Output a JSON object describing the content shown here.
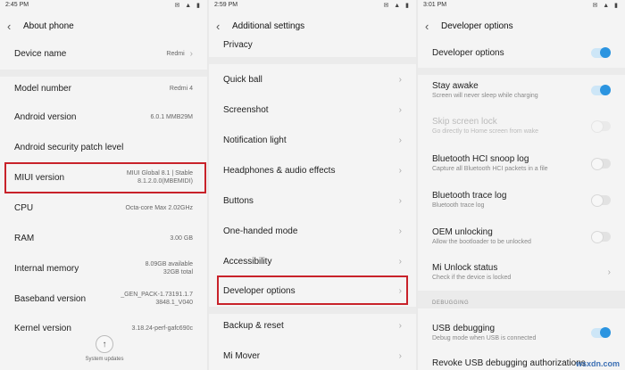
{
  "panel1": {
    "time": "2:45 PM",
    "status_icons": "✉ ▲ ▮",
    "title": "About phone",
    "rows": [
      {
        "label": "Device name",
        "value": "Redmi"
      },
      {
        "label": "Model number",
        "value": "Redmi 4"
      },
      {
        "label": "Android version",
        "value": "6.0.1 MMB29M"
      },
      {
        "label": "Android security patch level",
        "value": ""
      },
      {
        "label": "MIUI version",
        "value": "MIUI Global 8.1 | Stable 8.1.2.0.0(MBEMIDI)"
      },
      {
        "label": "CPU",
        "value": "Octa-core Max 2.02GHz"
      },
      {
        "label": "RAM",
        "value": "3.00 GB"
      },
      {
        "label": "Internal memory",
        "value": "8.09GB available 32GB total"
      },
      {
        "label": "Baseband version",
        "value": "_GEN_PACK-1.73191.1.7 3848.1_V040"
      },
      {
        "label": "Kernel version",
        "value": "3.18.24-perf-gafc690c"
      }
    ],
    "system_updates": "System updates"
  },
  "panel2": {
    "time": "2:59 PM",
    "status_icons": "✉ ▲ ▮",
    "title": "Additional settings",
    "rows": [
      {
        "label": "Privacy"
      },
      {
        "label": "Quick ball"
      },
      {
        "label": "Screenshot"
      },
      {
        "label": "Notification light"
      },
      {
        "label": "Headphones & audio effects"
      },
      {
        "label": "Buttons"
      },
      {
        "label": "One-handed mode"
      },
      {
        "label": "Accessibility"
      },
      {
        "label": "Developer options"
      },
      {
        "label": "Backup & reset"
      },
      {
        "label": "Mi Mover"
      }
    ]
  },
  "panel3": {
    "time": "3:01 PM",
    "status_icons": "✉ ▲ ▮",
    "title": "Developer options",
    "rows": [
      {
        "label": "Developer options",
        "sub": "",
        "toggle": "on"
      },
      {
        "label": "Stay awake",
        "sub": "Screen will never sleep while charging",
        "toggle": "on"
      },
      {
        "label": "Skip screen lock",
        "sub": "Go directly to Home screen from wake",
        "toggle": "off"
      },
      {
        "label": "Bluetooth HCI snoop log",
        "sub": "Capture all Bluetooth HCI packets in a file",
        "toggle": "off"
      },
      {
        "label": "Bluetooth trace log",
        "sub": "Bluetooth trace log",
        "toggle": "off"
      },
      {
        "label": "OEM unlocking",
        "sub": "Allow the bootloader to be unlocked",
        "toggle": "off"
      },
      {
        "label": "Mi Unlock status",
        "sub": "Check if the device is locked",
        "toggle": "nav"
      },
      {
        "label": "USB debugging",
        "sub": "Debug mode when USB is connected",
        "toggle": "on"
      },
      {
        "label": "Revoke USB debugging authorizations",
        "sub": "",
        "toggle": "none"
      }
    ],
    "section_debugging": "DEBUGGING"
  },
  "watermark": "wsxdn.com",
  "colors": {
    "accent": "#2b94e0",
    "highlight": "#c8222a"
  }
}
